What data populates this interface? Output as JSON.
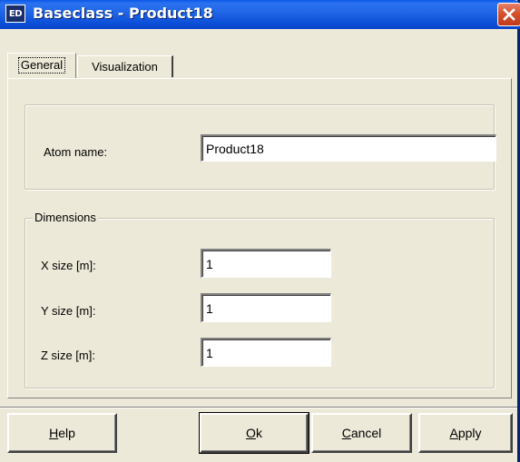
{
  "window": {
    "title": "Baseclass - Product18",
    "app_icon_text": "ED"
  },
  "tabs": [
    {
      "label": "General",
      "active": true
    },
    {
      "label": "Visualization",
      "active": false
    }
  ],
  "general": {
    "atom_name_label": "Atom name:",
    "atom_name_value": "Product18",
    "dimensions_legend": "Dimensions",
    "x_label": "X size [m]:",
    "x_value": "1",
    "y_label": "Y size [m]:",
    "y_value": "1",
    "z_label": "Z size [m]:",
    "z_value": "1"
  },
  "buttons": {
    "help": {
      "mnemonic": "H",
      "rest": "elp"
    },
    "ok": {
      "mnemonic": "O",
      "rest": "k"
    },
    "cancel": {
      "mnemonic": "C",
      "rest": "ancel"
    },
    "apply": {
      "mnemonic": "A",
      "rest": "pply"
    }
  },
  "colors": {
    "titlebar": "#0B4FD8",
    "dialog_face": "#ECE9D8",
    "close_button": "#D5512E"
  }
}
